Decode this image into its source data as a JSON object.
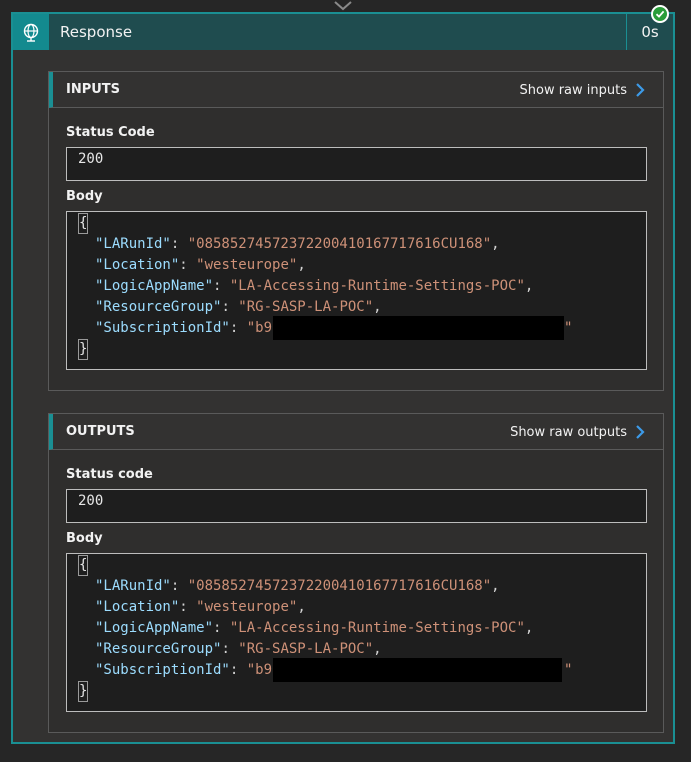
{
  "header": {
    "title": "Response",
    "duration": "0s"
  },
  "inputs": {
    "title": "INPUTS",
    "raw_link": "Show raw inputs",
    "status_label": "Status Code",
    "status_value": "200",
    "body_label": "Body",
    "body": {
      "open": "{",
      "close": "}",
      "lines": [
        {
          "key": "\"LARunId\"",
          "value": "\"08585274572372200410167717616CU168\"",
          "sep": ": ",
          "end": ","
        },
        {
          "key": "\"Location\"",
          "value": "\"westeurope\"",
          "sep": ": ",
          "end": ","
        },
        {
          "key": "\"LogicAppName\"",
          "value": "\"LA-Accessing-Runtime-Settings-POC\"",
          "sep": ": ",
          "end": ","
        },
        {
          "key": "\"ResourceGroup\"",
          "value": "\"RG-SASP-LA-POC\"",
          "sep": ": ",
          "end": ","
        },
        {
          "key": "\"SubscriptionId\"",
          "value": "\"b9",
          "sep": ": ",
          "end": ""
        }
      ],
      "redacted_tail": "\""
    }
  },
  "outputs": {
    "title": "OUTPUTS",
    "raw_link": "Show raw outputs",
    "status_label": "Status code",
    "status_value": "200",
    "body_label": "Body",
    "body": {
      "open": "{",
      "close": "}",
      "lines": [
        {
          "key": "\"LARunId\"",
          "value": "\"08585274572372200410167717616CU168\"",
          "sep": ": ",
          "end": ","
        },
        {
          "key": "\"Location\"",
          "value": "\"westeurope\"",
          "sep": ": ",
          "end": ","
        },
        {
          "key": "\"LogicAppName\"",
          "value": "\"LA-Accessing-Runtime-Settings-POC\"",
          "sep": ": ",
          "end": ","
        },
        {
          "key": "\"ResourceGroup\"",
          "value": "\"RG-SASP-LA-POC\"",
          "sep": ": ",
          "end": ","
        },
        {
          "key": "\"SubscriptionId\"",
          "value": "\"b9",
          "sep": ": ",
          "end": ""
        }
      ],
      "redacted_tail": "\""
    }
  },
  "colors": {
    "accent": "#1a8f93",
    "success": "#2a9d3a",
    "json_key": "#9cdcfe",
    "json_string": "#ce9178",
    "link_chevron": "#3c9ae8"
  }
}
